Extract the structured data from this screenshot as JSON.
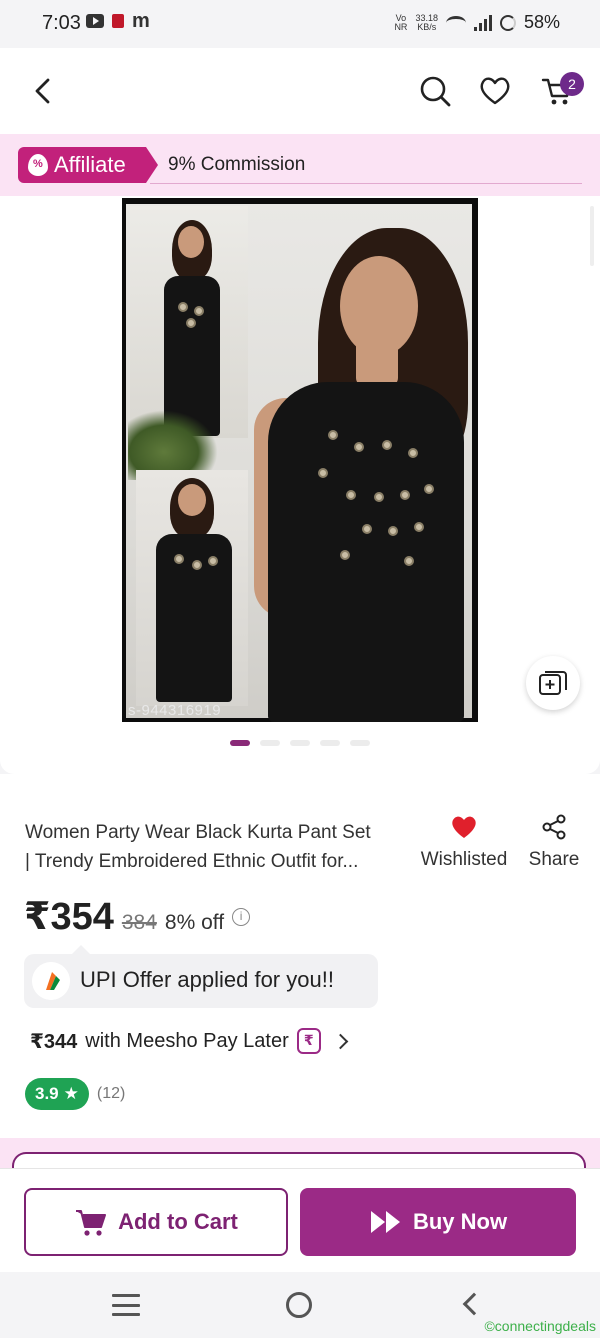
{
  "status_bar": {
    "time": "7:03",
    "net_top": "Vo",
    "net_bottom": "NR",
    "speed_value": "33.18",
    "speed_unit": "KB/s",
    "battery": "58%"
  },
  "header": {
    "cart_count": "2",
    "icons": [
      "back-icon",
      "search-icon",
      "heart-icon",
      "cart-icon"
    ]
  },
  "affiliate": {
    "label": "Affiliate",
    "commission": "9% Commission"
  },
  "gallery": {
    "sku_watermark": "s-944316919",
    "dots_count": 5,
    "active_dot": 0
  },
  "product": {
    "title_line1": "Women Party Wear Black Kurta Pant Set",
    "title_line2": "| Trendy Embroidered Ethnic Outfit for...",
    "wishlist_label": "Wishlisted",
    "share_label": "Share",
    "price": "₹354",
    "mrp": "384",
    "discount": "8% off",
    "upi_offer": "UPI Offer applied for you!!",
    "paylater_amount": "₹344",
    "paylater_text": "with Meesho Pay Later",
    "rating": "3.9",
    "rating_count": "(12)"
  },
  "actions": {
    "add_to_cart": "Add to Cart",
    "buy_now": "Buy Now"
  },
  "colors": {
    "brand": "#9b2a86",
    "affiliate": "#c2217b",
    "rating_green": "#1fa354",
    "heart_red": "#e0202c"
  },
  "watermark": "©connectingdeals"
}
